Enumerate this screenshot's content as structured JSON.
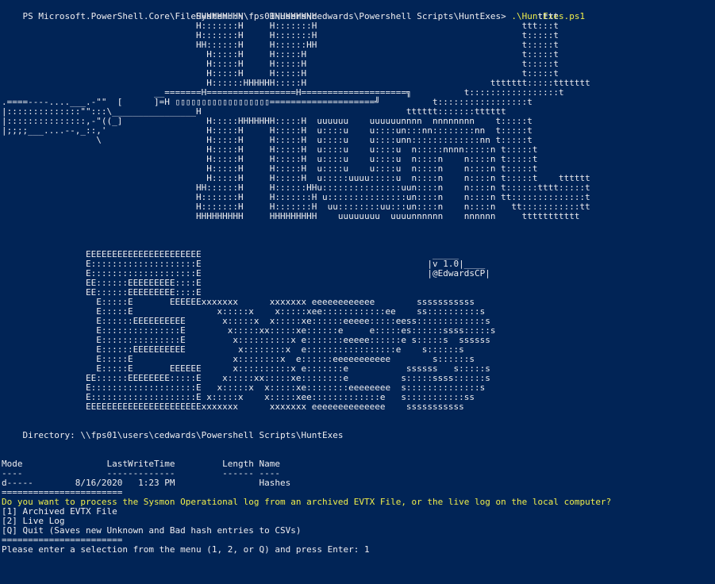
{
  "theme": {
    "background": "#012456",
    "foreground": "#eeedf0",
    "accent_yellow": "#f0ee4a"
  },
  "prompt": {
    "path": "PS Microsoft.PowerShell.Core\\FileSystem::\\\\fps01\\users\\cedwards\\Powershell Scripts\\HuntExes> ",
    "command": ".\\HuntExes.ps1"
  },
  "banner_huntexe": [
    "                                     HHHHHHHHH     HHHHHHHHH                                          tttt",
    "                                     H:::::::H     H:::::::H                                       ttt:::t",
    "                                     H:::::::H     H:::::::H                                       t:::::t",
    "                                     HH::::::H     H::::::HH                                       t:::::t",
    "                                       H:::::H     H:::::H                                         t:::::t",
    "                                       H:::::H     H:::::H                                         t:::::t",
    "                                       H:::::H     H:::::H                                         t:::::t",
    "                                       H::::::HHHHHH:::::H                                   ttttttt:::::ttttttt",
    "                             __=======H=================H====================╗          t:::::::::::::::::t",
    ".====----....___.-\"\"  [      ]=H ▯▯▯▯▯▯▯▯▯▯▯▯▯▯▯▯▯▯====================╝          t:::::::::::::::::t",
    "|::::::::::::::\"\":::\\________________H                                       tttttt:::::::tttttt",
    "|:::::::::::::::,-\"((_]                H:::::HHHHHHH:::::H  uuuuuu    uuuuuunnnn  nnnnnnnn    t:::::t",
    "|;;;;___....--,_::,'                   H:::::H     H:::::H  u::::u    u::::un:::nn::::::::nn  t:::::t",
    "                  \\                    H:::::H     H:::::H  u::::u    u::::unn:::::::::::::nn t:::::t",
    "                                       H:::::H     H:::::H  u::::u    u::::u  n:::::nnnn:::::n t:::::t",
    "                                       H:::::H     H:::::H  u::::u    u::::u  n::::n    n::::n t:::::t",
    "                                       H:::::H     H:::::H  u::::u    u::::u  n::::n    n::::n t:::::t",
    "                                       H:::::H     H:::::H  u:::::uuuu:::::u  n::::n    n::::n t:::::t    tttttt",
    "                                     HH::::::H     H::::::HHu:::::::::::::::uun::::n    n::::n t::::::tttt:::::t",
    "                                     H:::::::H     H:::::::H u:::::::::::::::un::::n    n::::n tt::::::::::::::t",
    "                                     H:::::::H     H:::::::H  uu::::::::uu:::un::::n    n::::n   tt:::::::::::tt",
    "                                     HHHHHHHHH     HHHHHHHHH    uuuuuuuu  uuuunnnnnn    nnnnnn     ttttttttttt"
  ],
  "version_tag": [
    "                                                                                  _____",
    "                                                                                 |v 1.0|____",
    "                                                                                 |@EdwardsCP|"
  ],
  "banner_exes": [
    "                EEEEEEEEEEEEEEEEEEEEEE",
    "                E::::::::::::::::::::E",
    "                E::::::::::::::::::::E",
    "                EE::::::EEEEEEEEE::::E",
    "                EE::::::EEEEEEEEE::::E",
    "                  E:::::E       EEEEEExxxxxxx      xxxxxxx eeeeeeeeeeee        sssssssssss",
    "                  E:::::E                x:::::x    x:::::xee::::::::::::ee    ss::::::::::s",
    "                  E::::::EEEEEEEEEE       x:::::x  x:::::xe::::::eeeee:::::eess:::::::::::::s",
    "                  E:::::::::::::::E        x:::::xx:::::xe::::::e     e:::::es::::::ssss:::::s",
    "                  E:::::::::::::::E         x::::::::::x e:::::::eeeee::::::e s:::::s  ssssss",
    "                  E::::::EEEEEEEEEE          x::::::::x  e:::::::::::::::::e    s::::::s",
    "                  E:::::E                   x::::::::x  e::::::eeeeeeeeeee        s::::::s",
    "                  E:::::E       EEEEEE      x::::::::::x e:::::::e           ssssss   s:::::s",
    "                EE::::::EEEEEEEE:::::E    x:::::xx:::::xe::::::::e          s:::::ssss::::::s",
    "                E::::::::::::::::::::E   x:::::x  x:::::xe::::::::eeeeeeee  s::::::::::::::s",
    "                E::::::::::::::::::::E x:::::x    x:::::xee:::::::::::::e   s:::::::::::ss",
    "                EEEEEEEEEEEEEEEEEEEEEExxxxxxx      xxxxxxx eeeeeeeeeeeeee    sssssssssss"
  ],
  "directory": {
    "label": "    Directory: \\\\fps01\\users\\cedwards\\Powershell Scripts\\HuntExes"
  },
  "listing": {
    "header": "Mode                LastWriteTime         Length Name",
    "underline": "----                -------------         ------ ----",
    "rows": [
      "d-----        8/16/2020   1:23 PM                Hashes"
    ]
  },
  "menu": {
    "separator_top": "=======================",
    "question": "Do you want to process the Sysmon Operational log from an archived EVTX File, or the live log on the local computer?",
    "options": [
      "[1] Archived EVTX File",
      "[2] Live Log",
      "[Q] Quit (Saves new Unknown and Bad hash entries to CSVs)"
    ],
    "separator_bottom": "=======================",
    "input_prompt": "Please enter a selection from the menu (1, 2, or Q) and press Enter: 1"
  }
}
